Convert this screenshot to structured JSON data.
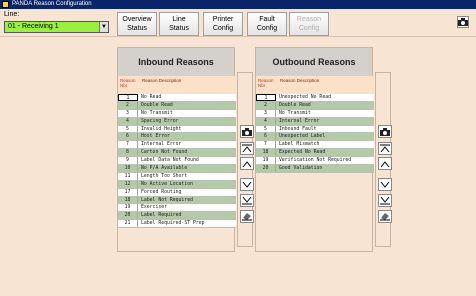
{
  "window": {
    "title": "PANDA Reason Configuration"
  },
  "toolbar": {
    "line_label": "Line:",
    "line_value": "01 - Receiving 1",
    "buttons": [
      {
        "label1": "Overview",
        "label2": "Status",
        "disabled": false
      },
      {
        "label1": "Line",
        "label2": "Status",
        "disabled": false
      },
      {
        "label1": "Printer",
        "label2": "Config",
        "disabled": false
      },
      {
        "label1": "Fault",
        "label2": "Config",
        "disabled": false
      },
      {
        "label1": "Reason",
        "label2": "Config",
        "disabled": true
      }
    ]
  },
  "inbound": {
    "title": "Inbound Reasons",
    "head_nbr": "Reason Nbr",
    "head_desc": "Reason Description",
    "rows": [
      [
        "1",
        "No Read"
      ],
      [
        "2",
        "Double Read"
      ],
      [
        "3",
        "No Transmit"
      ],
      [
        "4",
        "Spacing Error"
      ],
      [
        "5",
        "Invalid Height"
      ],
      [
        "6",
        "Host Error"
      ],
      [
        "7",
        "Internal Error"
      ],
      [
        "8",
        "Carton Not Found"
      ],
      [
        "9",
        "Label Data Not Found"
      ],
      [
        "10",
        "No P/A Available"
      ],
      [
        "11",
        "Length Too Short"
      ],
      [
        "12",
        "No Active Location"
      ],
      [
        "17",
        "Forced Routing"
      ],
      [
        "18",
        "Label Not Required"
      ],
      [
        "19",
        "Exerciser"
      ],
      [
        "20",
        "Label Required"
      ],
      [
        "21",
        "Label Required-ST Prep"
      ]
    ]
  },
  "outbound": {
    "title": "Outbound Reasons",
    "head_nbr": "Reason Nbr",
    "head_desc": "Reason Description",
    "rows": [
      [
        "1",
        "Unexpected No Read"
      ],
      [
        "2",
        "Double Read"
      ],
      [
        "3",
        "No Transmit"
      ],
      [
        "4",
        "Internal Error"
      ],
      [
        "5",
        "Inbound Fault"
      ],
      [
        "6",
        "Unexpected Label"
      ],
      [
        "7",
        "Label Mismatch"
      ],
      [
        "18",
        "Expected No Read"
      ],
      [
        "19",
        "Verification Not Required"
      ],
      [
        "20",
        "Good Validation"
      ]
    ]
  }
}
